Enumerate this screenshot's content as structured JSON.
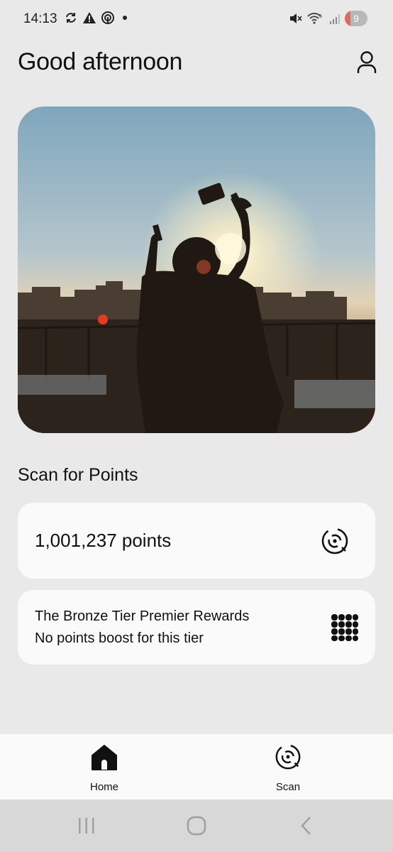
{
  "status_bar": {
    "time": "14:13",
    "battery_level": "9",
    "left_icons": [
      "sync-icon",
      "alert-icon",
      "data-saver-icon",
      "dot-icon"
    ],
    "right_icons": [
      "mute-icon",
      "wifi-5g-icon",
      "signal-icon"
    ]
  },
  "header": {
    "greeting": "Good afternoon",
    "profile_icon": "person-icon"
  },
  "hero": {
    "image": "silhouette-on-rooftop-at-sunset"
  },
  "scan_section": {
    "title": "Scan for Points",
    "points_label": "1,001,237 points",
    "points_icon": "scan-icon"
  },
  "tier": {
    "name": "The Bronze Tier Premier Rewards",
    "boost": "No points boost for this tier",
    "icon": "tier-grid-icon"
  },
  "bottom_nav": {
    "items": [
      {
        "label": "Home",
        "icon": "home-icon",
        "active": true
      },
      {
        "label": "Scan",
        "icon": "scan-icon",
        "active": false
      }
    ]
  },
  "system_nav": {
    "buttons": [
      "recents-icon",
      "home-circle-icon",
      "back-icon"
    ]
  },
  "colors": {
    "background": "#e9e9e9",
    "card": "#fafafa",
    "text": "#111111",
    "battery_low": "#e06a62"
  }
}
